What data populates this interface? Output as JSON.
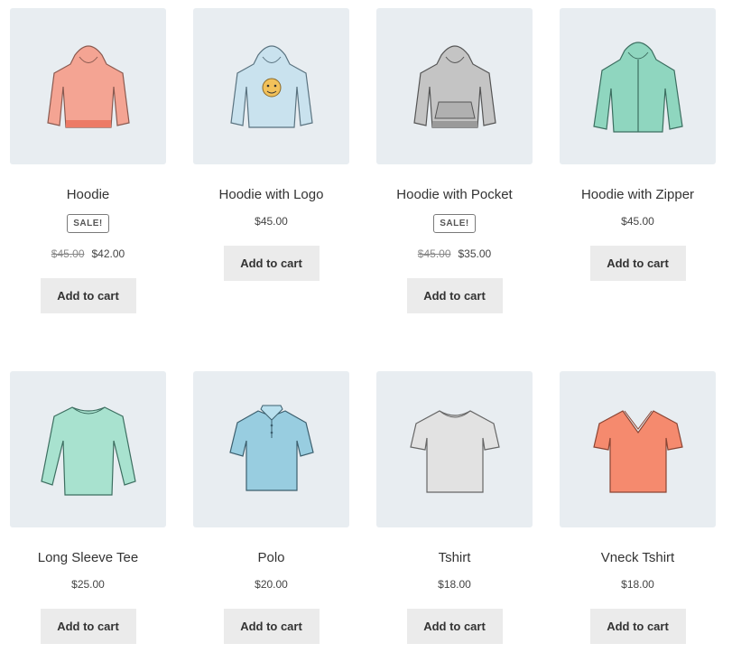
{
  "colors": {
    "tile_bg": "#e8edf1",
    "button_bg": "#ebebeb"
  },
  "products": [
    {
      "title": "Hoodie",
      "badge": "SALE!",
      "old_price": "$45.00",
      "price": "$42.00",
      "button": "Add to cart",
      "icon": "hoodie-icon"
    },
    {
      "title": "Hoodie with Logo",
      "price": "$45.00",
      "button": "Add to cart",
      "icon": "hoodie-logo-icon"
    },
    {
      "title": "Hoodie with Pocket",
      "badge": "SALE!",
      "old_price": "$45.00",
      "price": "$35.00",
      "button": "Add to cart",
      "icon": "hoodie-pocket-icon"
    },
    {
      "title": "Hoodie with Zipper",
      "price": "$45.00",
      "button": "Add to cart",
      "icon": "hoodie-zipper-icon"
    },
    {
      "title": "Long Sleeve Tee",
      "price": "$25.00",
      "button": "Add to cart",
      "icon": "long-sleeve-tee-icon"
    },
    {
      "title": "Polo",
      "price": "$20.00",
      "button": "Add to cart",
      "icon": "polo-icon"
    },
    {
      "title": "Tshirt",
      "price": "$18.00",
      "button": "Add to cart",
      "icon": "tshirt-icon"
    },
    {
      "title": "Vneck Tshirt",
      "price": "$18.00",
      "button": "Add to cart",
      "icon": "vneck-tshirt-icon"
    }
  ]
}
